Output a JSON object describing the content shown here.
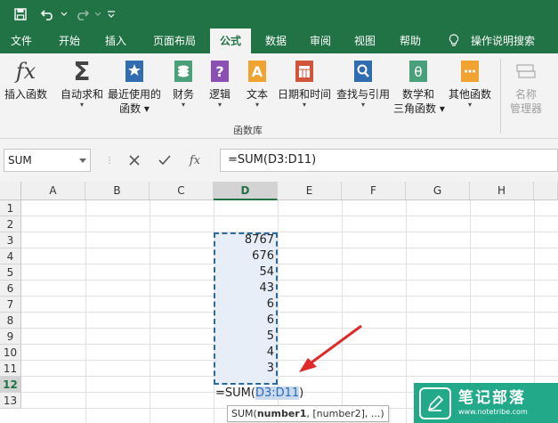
{
  "quick_access": {
    "save_icon": "save-icon",
    "undo_icon": "undo-icon",
    "redo_icon": "redo-icon",
    "customize_icon": "customize-quick-access-icon"
  },
  "tabs": [
    {
      "label": "文件",
      "active": false
    },
    {
      "label": "开始",
      "active": false
    },
    {
      "label": "插入",
      "active": false
    },
    {
      "label": "页面布局",
      "active": false
    },
    {
      "label": "公式",
      "active": true
    },
    {
      "label": "数据",
      "active": false
    },
    {
      "label": "审阅",
      "active": false
    },
    {
      "label": "视图",
      "active": false
    },
    {
      "label": "帮助",
      "active": false
    }
  ],
  "tell_me": {
    "icon": "lightbulb-icon",
    "label": "操作说明搜索"
  },
  "ribbon": {
    "insert_function": {
      "label": "插入函数",
      "icon": "fx-icon"
    },
    "autosum": {
      "label": "自动求和",
      "icon": "sigma-icon"
    },
    "recent": {
      "line1": "最近使用的",
      "line2": "函数",
      "icon": "star-book-icon"
    },
    "financial": {
      "label": "财务",
      "icon": "money-book-icon"
    },
    "logical": {
      "label": "逻辑",
      "icon": "question-book-icon"
    },
    "text": {
      "label": "文本",
      "icon": "text-book-icon"
    },
    "datetime": {
      "label": "日期和时间",
      "icon": "calendar-book-icon"
    },
    "lookup": {
      "label": "查找与引用",
      "icon": "search-book-icon"
    },
    "math": {
      "line1": "数学和",
      "line2": "三角函数",
      "icon": "theta-book-icon"
    },
    "more": {
      "label": "其他函数",
      "icon": "more-book-icon"
    },
    "name_manager": {
      "line1": "名称",
      "line2": "管理器",
      "icon": "name-manager-icon"
    },
    "group_label": "函数库"
  },
  "formula_bar": {
    "name_box": "SUM",
    "cancel_icon": "cancel-x-icon",
    "enter_icon": "check-icon",
    "fx_label": "fx",
    "formula": "=SUM(D3:D11)"
  },
  "columns": [
    "A",
    "B",
    "C",
    "D",
    "E",
    "F",
    "G",
    "H"
  ],
  "rows": [
    "1",
    "2",
    "3",
    "4",
    "5",
    "6",
    "7",
    "8",
    "9",
    "10",
    "11",
    "12",
    "13"
  ],
  "d_values": [
    "8767",
    "676",
    "54",
    "43",
    "6",
    "6",
    "5",
    "4",
    "3"
  ],
  "edit_cell": {
    "prefix": "=SUM(",
    "ref": "D3:D11",
    "suffix": ")"
  },
  "tooltip": {
    "fn": "SUM(",
    "arg1": "number1",
    "rest": ", [number2], ...)"
  },
  "watermark": {
    "title": "笔记部落",
    "url": "www.notetribe.com"
  },
  "colors": {
    "accent": "#217346",
    "selection": "#2a6a9c",
    "arrow": "#e02a2a",
    "watermark": "#21a98a"
  }
}
